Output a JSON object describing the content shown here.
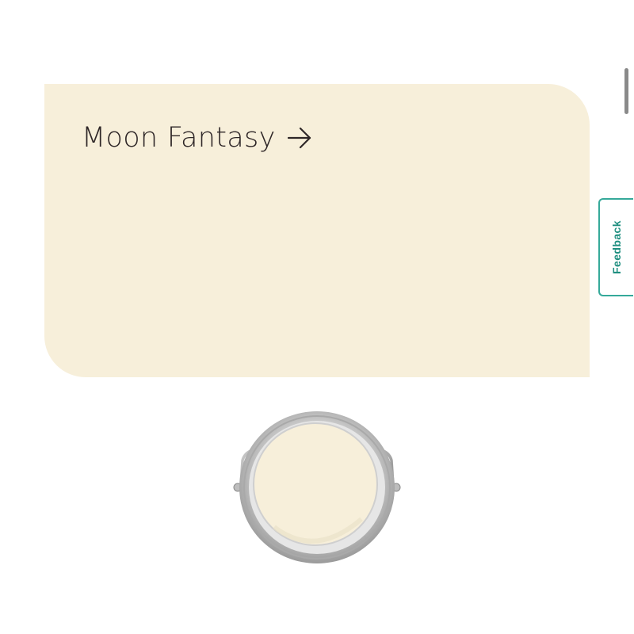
{
  "color": {
    "name": "Moon Fantasy",
    "swatch_hex": "#f7efda",
    "title_color": "#2e2627"
  },
  "feedback": {
    "label": "Feedback",
    "accent": "#35a99a"
  },
  "icons": {
    "arrow": "arrow-right-icon",
    "product": "paint-can-icon"
  }
}
